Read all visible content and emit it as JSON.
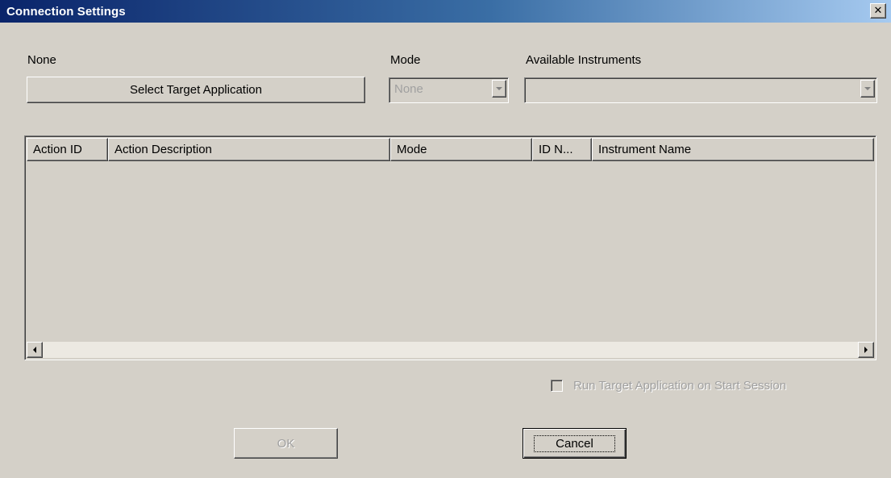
{
  "window": {
    "title": "Connection Settings",
    "close_glyph": "✕",
    "close_icon": "close-icon"
  },
  "target": {
    "current_label": "None",
    "select_button_label": "Select Target Application"
  },
  "mode": {
    "label": "Mode",
    "selected_value": "None",
    "enabled": false
  },
  "instruments": {
    "label": "Available Instruments",
    "selected_value": "",
    "enabled": false
  },
  "actions_table": {
    "columns": [
      "Action ID",
      "Action Description",
      "Mode",
      "ID N...",
      "Instrument Name"
    ],
    "rows": []
  },
  "run_on_start": {
    "label": "Run Target Application on Start Session",
    "checked": false,
    "enabled": false
  },
  "footer": {
    "ok_label": "OK",
    "ok_enabled": false,
    "cancel_label": "Cancel"
  }
}
